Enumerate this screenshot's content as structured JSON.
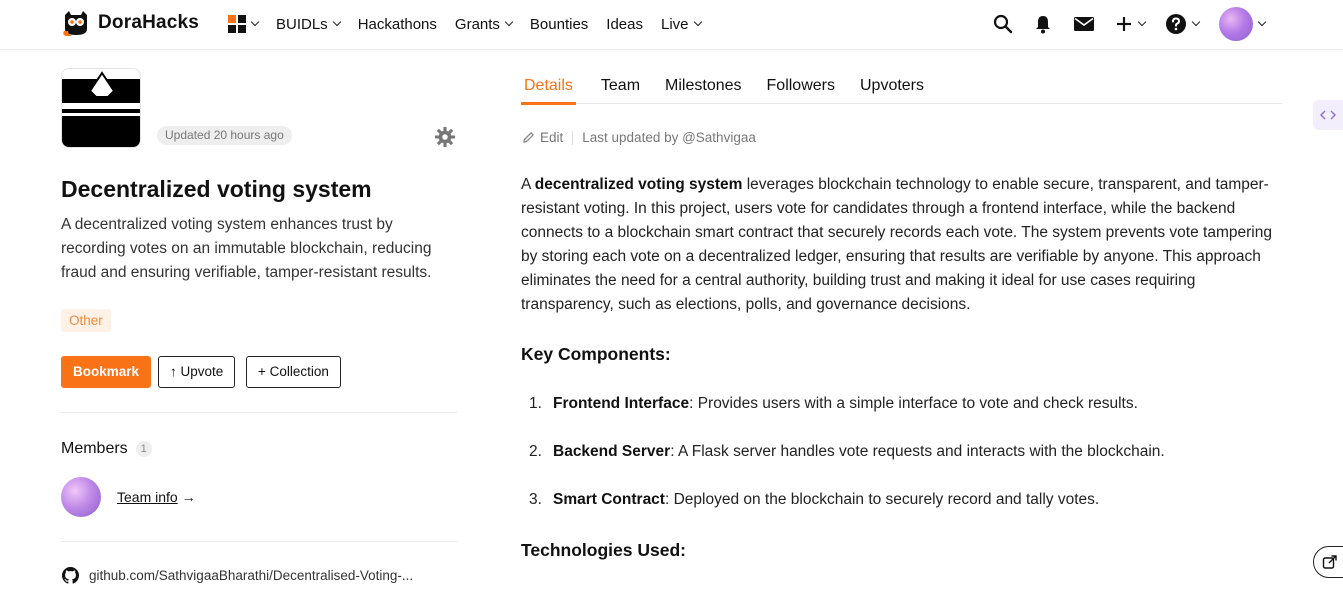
{
  "brand": {
    "name": "DoraHacks",
    "accent": "#f97316"
  },
  "nav": {
    "items": [
      {
        "label": "BUIDLs",
        "has_menu": true
      },
      {
        "label": "Hackathons",
        "has_menu": false
      },
      {
        "label": "Grants",
        "has_menu": true
      },
      {
        "label": "Bounties",
        "has_menu": false
      },
      {
        "label": "Ideas",
        "has_menu": false
      },
      {
        "label": "Live",
        "has_menu": true
      }
    ],
    "right_icons": [
      "search-icon",
      "bell-icon",
      "mail-icon",
      "plus-icon",
      "help-icon",
      "user-avatar"
    ]
  },
  "project": {
    "updated": "Updated 20 hours ago",
    "title": "Decentralized voting system",
    "description": "A decentralized voting system enhances trust by recording votes on an immutable blockchain, reducing fraud and ensuring verifiable, tamper-resistant results.",
    "tag": "Other",
    "buttons": {
      "bookmark": "Bookmark",
      "upvote": "↑ Upvote",
      "collection": "+ Collection"
    },
    "members_label": "Members",
    "members_count": "1",
    "team_info": "Team info",
    "team_info_arrow": "→",
    "github": "github.com/SathvigaaBharathi/Decentralised-Voting-..."
  },
  "tabs": [
    "Details",
    "Team",
    "Milestones",
    "Followers",
    "Upvoters"
  ],
  "active_tab": "Details",
  "details": {
    "edit_label": "Edit",
    "last_updated": "Last updated by @Sathvigaa",
    "intro_prefix": "A ",
    "intro_bold": "decentralized voting system",
    "intro_rest": " leverages blockchain technology to enable secure, transparent, and tamper-resistant voting. In this project, users vote for candidates through a frontend interface, while the backend connects to a blockchain smart contract that securely records each vote. The system prevents vote tampering by storing each vote on a decentralized ledger, ensuring that results are verifiable by anyone. This approach eliminates the need for a central authority, building trust and making it ideal for use cases requiring transparency, such as elections, polls, and governance decisions.",
    "key_components_heading": "Key Components:",
    "components": [
      {
        "num": "1.",
        "name": "Frontend Interface",
        "text": ": Provides users with a simple interface to vote and check results."
      },
      {
        "num": "2.",
        "name": "Backend Server",
        "text": ": A Flask server handles vote requests and interacts with the blockchain."
      },
      {
        "num": "3.",
        "name": "Smart Contract",
        "text": ": Deployed on the blockchain to securely record and tally votes."
      }
    ],
    "technologies_heading": "Technologies Used:"
  }
}
